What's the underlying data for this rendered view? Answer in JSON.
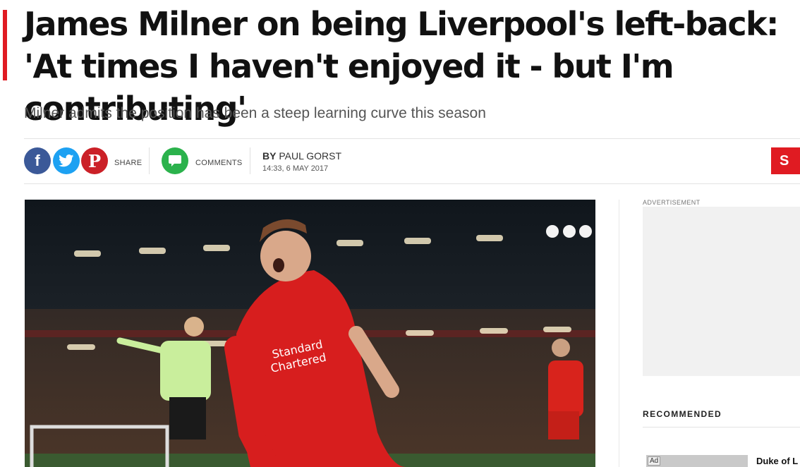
{
  "article": {
    "headline": "James Milner on being Liverpool's left-back: 'At times I haven't enjoyed it - but I'm contributing'",
    "standfirst": "Milner admits the position has been a steep learning curve this season",
    "byline_prefix": "BY",
    "author": "PAUL GORST",
    "timestamp": "14:33, 6 MAY 2017"
  },
  "share": {
    "facebook_glyph": "f",
    "pinterest_glyph": "P",
    "share_label": "SHARE",
    "comments_label": "COMMENTS",
    "subscribe_fragment": "S"
  },
  "sidebar": {
    "ad_label": "ADVERTISEMENT",
    "recommended_heading": "RECOMMENDED",
    "recommended_items": [
      {
        "ad_tag": "Ad",
        "title": "Duke of L"
      }
    ]
  },
  "colors": {
    "accent": "#e01b22",
    "facebook": "#3b5998",
    "twitter": "#1da1f2",
    "pinterest": "#cb2027",
    "comments": "#2bb24c"
  },
  "icons": [
    "facebook-icon",
    "twitter-icon",
    "pinterest-icon",
    "comment-bubble-icon"
  ]
}
